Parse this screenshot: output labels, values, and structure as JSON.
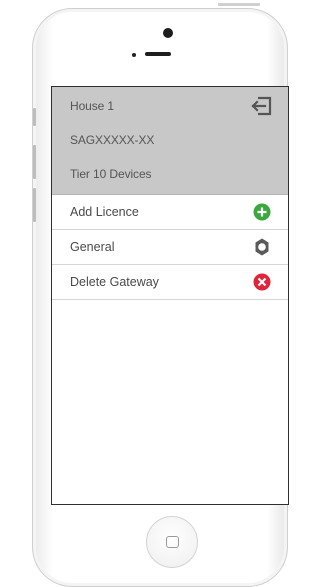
{
  "header": {
    "gateway_name": "House 1",
    "serial": "SAGXXXXX-XX",
    "tier": "Tier 10 Devices",
    "logout_icon": "logout-icon"
  },
  "menu": [
    {
      "label": "Add Licence",
      "icon": "add-icon",
      "icon_color": "#3aa83d"
    },
    {
      "label": "General",
      "icon": "gear-icon",
      "icon_color": "#5a5a5a"
    },
    {
      "label": "Delete Gateway",
      "icon": "delete-icon",
      "icon_color": "#e0243a"
    }
  ],
  "colors": {
    "header_bg": "#c8c8c8",
    "text": "#4a4a4a"
  }
}
